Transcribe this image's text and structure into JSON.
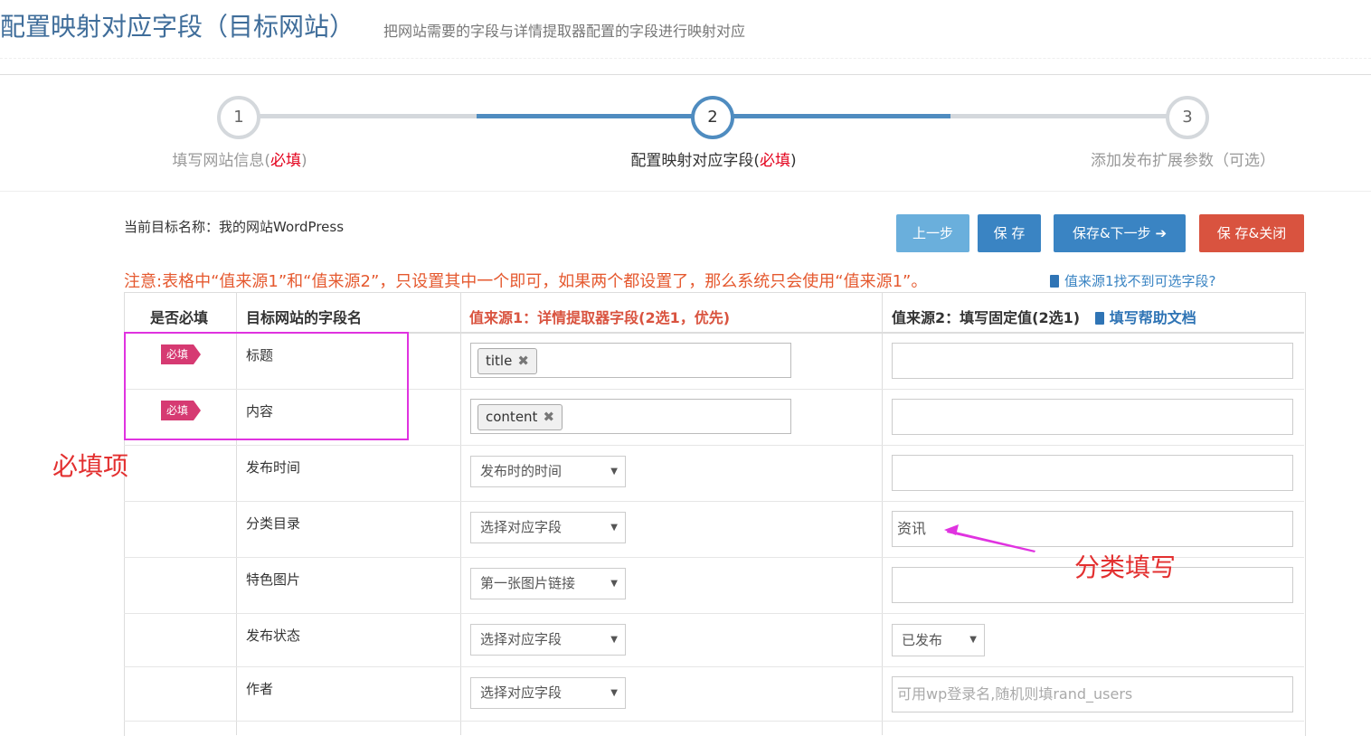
{
  "header": {
    "title": "配置映射对应字段（目标网站）",
    "subtitle": "把网站需要的字段与详情提取器配置的字段进行映射对应"
  },
  "wizard": {
    "steps": [
      {
        "number": "1",
        "label": "填写网站信息(",
        "required": "必填",
        "close": ")",
        "state": "done"
      },
      {
        "number": "2",
        "label": "配置映射对应字段(",
        "required": "必填",
        "close": ")",
        "state": "active"
      },
      {
        "number": "3",
        "label": "添加发布扩展参数（可选）",
        "state": "pending"
      }
    ]
  },
  "target": {
    "label": "当前目标名称：我的网站WordPress"
  },
  "buttons": {
    "prev": "上一步",
    "save": "保 存",
    "save_next": "保存&下一步",
    "save_close": "保 存&关闭"
  },
  "notice": "注意:表格中“值来源1”和“值来源2”，只设置其中一个即可，如果两个都设置了，那么系统只会使用“值来源1”。",
  "help_link": "值来源1找不到可选字段?",
  "table": {
    "headers": {
      "required": "是否必填",
      "field_name": "目标网站的字段名",
      "source1": "值来源1：详情提取器字段(2选1，优先)",
      "source2": "值来源2：填写固定值(2选1)",
      "help_doc": "填写帮助文档"
    },
    "required_tag": "必填",
    "rows": [
      {
        "name": "标题",
        "required": true,
        "chip": "title",
        "value": ""
      },
      {
        "name": "内容",
        "required": true,
        "chip": "content",
        "value": ""
      },
      {
        "name": "发布时间",
        "required": false,
        "select": "发布时的时间",
        "value": ""
      },
      {
        "name": "分类目录",
        "required": false,
        "select": "选择对应字段",
        "value": "资讯"
      },
      {
        "name": "特色图片",
        "required": false,
        "select": "第一张图片链接",
        "value": ""
      },
      {
        "name": "发布状态",
        "required": false,
        "select": "选择对应字段",
        "value_select": "已发布"
      },
      {
        "name": "作者",
        "required": false,
        "select": "选择对应字段",
        "placeholder": "可用wp登录名,随机则填rand_users"
      }
    ]
  },
  "annotations": {
    "required_items": "必填项",
    "category_fill": "分类填写"
  },
  "colors": {
    "accent": "#4f8cc0",
    "danger": "#d9533f",
    "tag": "#d63a72",
    "annotation": "#e33030",
    "highlight": "#e033e0"
  }
}
